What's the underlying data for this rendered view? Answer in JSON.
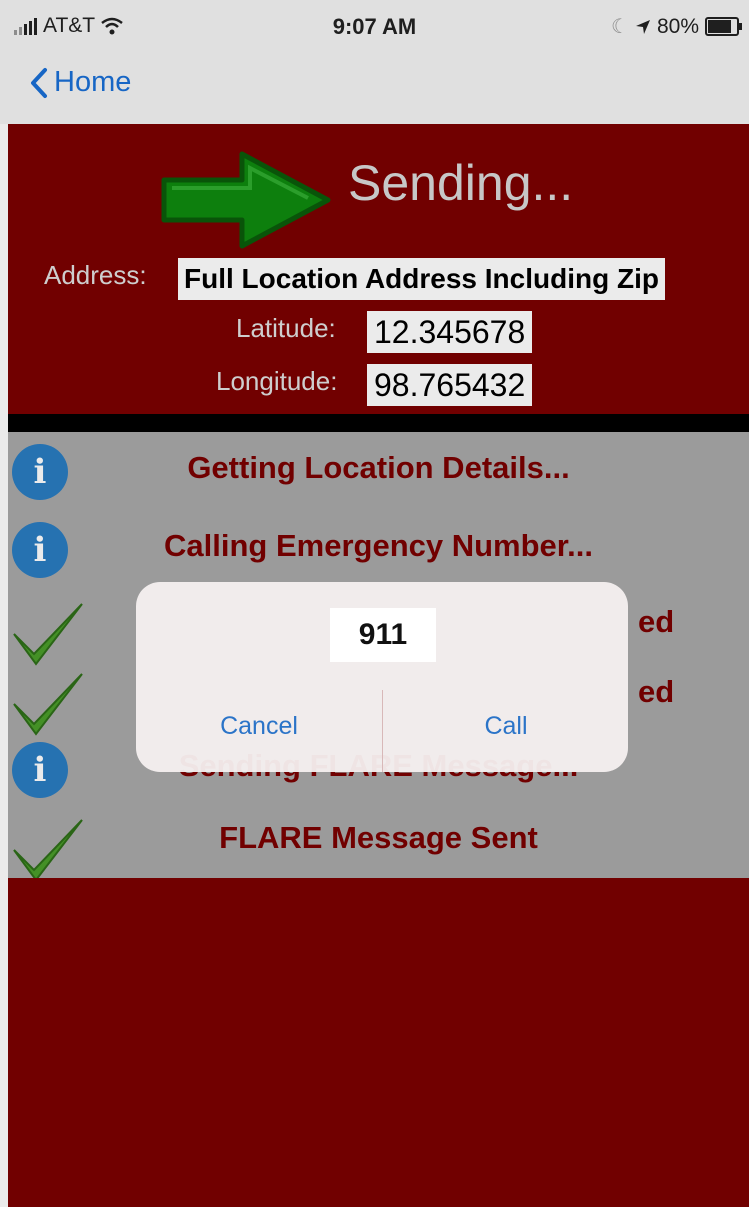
{
  "status_bar": {
    "carrier": "AT&T",
    "time": "9:07 AM",
    "battery": "80%"
  },
  "nav": {
    "back_label": "Home"
  },
  "header": {
    "title": "Sending...",
    "address_label": "Address:",
    "address_value": "Full Location Address Including Zip",
    "latitude_label": "Latitude:",
    "latitude_value": "12.345678",
    "longitude_label": "Longitude:",
    "longitude_value": "98.765432"
  },
  "steps": [
    {
      "status": "info",
      "label": "Getting Location Details..."
    },
    {
      "status": "info",
      "label": "Calling Emergency Number..."
    },
    {
      "status": "done",
      "label": "ed"
    },
    {
      "status": "done",
      "label": "ed"
    },
    {
      "status": "info",
      "label": "Sending FLARE Message..."
    },
    {
      "status": "done",
      "label": "FLARE Message Sent"
    }
  ],
  "dialog": {
    "title": "911",
    "cancel_label": "Cancel",
    "call_label": "Call"
  },
  "colors": {
    "brand_red": "#7b0000",
    "list_gray": "#a9a9a9",
    "link_blue": "#1a6fd6",
    "info_blue": "#2a7cc0",
    "check_green": "#4a9d2a"
  }
}
